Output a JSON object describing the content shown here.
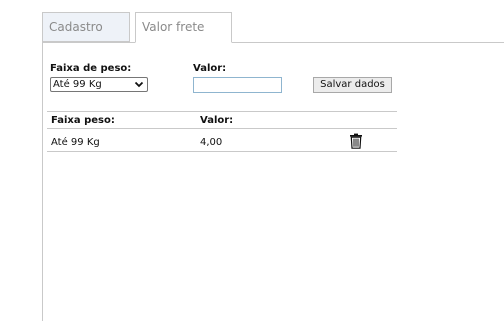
{
  "tabs": [
    {
      "label": "Cadastro",
      "active": false
    },
    {
      "label": "Valor frete",
      "active": true
    }
  ],
  "form": {
    "faixa_label": "Faixa de peso:",
    "faixa_selected": "Até 99 Kg",
    "valor_label": "Valor:",
    "valor_value": "",
    "save_label": "Salvar dados"
  },
  "table": {
    "headers": [
      "Faixa peso:",
      "Valor:"
    ],
    "rows": [
      {
        "faixa": "Até 99 Kg",
        "valor": "4,00",
        "action_icon": "trash-icon"
      }
    ]
  },
  "colors": {
    "border": "#c9c9c9",
    "inactive_tab_bg": "#eef2f8",
    "input_border": "#8fb5cf"
  }
}
